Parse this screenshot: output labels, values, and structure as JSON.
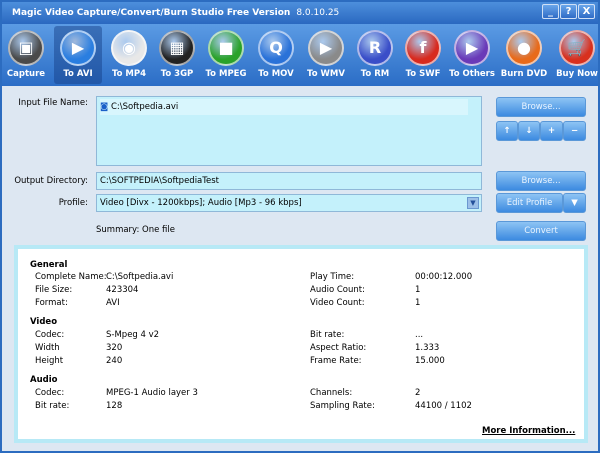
{
  "window": {
    "title": "Magic Video Capture/Convert/Burn Studio Free Version",
    "version": "8.0.10.25",
    "controls": [
      "_",
      "?",
      "X"
    ]
  },
  "toolbar": [
    {
      "label": "Capture",
      "icon": "capture-icon",
      "color": "#4a4a4a",
      "glyph": "▣"
    },
    {
      "label": "To AVI",
      "icon": "play-icon",
      "color": "#2a7ee0",
      "glyph": "▶",
      "selected": true
    },
    {
      "label": "To MP4",
      "icon": "ipod-icon",
      "color": "#e8e8e8",
      "glyph": "◉"
    },
    {
      "label": "To 3GP",
      "icon": "phone-icon",
      "color": "#222222",
      "glyph": "▦"
    },
    {
      "label": "To MPEG",
      "icon": "camera-icon",
      "color": "#2aa22a",
      "glyph": "■"
    },
    {
      "label": "To MOV",
      "icon": "quicktime-icon",
      "color": "#2a72d8",
      "glyph": "Q"
    },
    {
      "label": "To WMV",
      "icon": "wmv-icon",
      "color": "#8a8a8a",
      "glyph": "▶"
    },
    {
      "label": "To RM",
      "icon": "realmedia-icon",
      "color": "#3a4ec8",
      "glyph": "R"
    },
    {
      "label": "To SWF",
      "icon": "flash-icon",
      "color": "#d82a1e",
      "glyph": "f"
    },
    {
      "label": "To Others",
      "icon": "others-icon",
      "color": "#6a3ab8",
      "glyph": "▶"
    },
    {
      "label": "Burn DVD",
      "icon": "dvd-icon",
      "color": "#e86a1a",
      "glyph": "●"
    },
    {
      "label": "Buy Now",
      "icon": "cart-icon",
      "color": "#d8301e",
      "glyph": "🛒"
    }
  ],
  "form": {
    "input_label": "Input File Name:",
    "input_file": "C:\\Softpedia.avi",
    "output_label": "Output Directory:",
    "output_dir": "C:\\SOFTPEDIA\\SoftpediaTest",
    "profile_label": "Profile:",
    "profile": "Video [Divx - 1200kbps]; Audio [Mp3 - 96 kbps]",
    "summary": "Summary: One file",
    "browse": "Browse...",
    "browse2": "Browse...",
    "edit_profile": "Edit Profile",
    "convert": "Convert",
    "move_up": "↑",
    "move_down": "↓",
    "add": "+",
    "remove": "−"
  },
  "info": {
    "general": "General",
    "complete_name_l": "Complete Name:",
    "complete_name": "C:\\Softpedia.avi",
    "file_size_l": "File Size:",
    "file_size": "423304",
    "format_l": "Format:",
    "format": "AVI",
    "play_time_l": "Play Time:",
    "play_time": "00:00:12.000",
    "audio_count_l": "Audio Count:",
    "audio_count": "1",
    "video_count_l": "Video Count:",
    "video_count": "1",
    "video": "Video",
    "vcodec_l": "Codec:",
    "vcodec": "S-Mpeg 4 v2",
    "width_l": "Width",
    "width": "320",
    "height_l": "Height",
    "height": "240",
    "vbitrate_l": "Bit rate:",
    "vbitrate": "...",
    "aspect_l": "Aspect Ratio:",
    "aspect": "1.333",
    "framerate_l": "Frame Rate:",
    "framerate": "15.000",
    "audio": "Audio",
    "acodec_l": "Codec:",
    "acodec": "MPEG-1 Audio layer 3",
    "abitrate_l": "Bit rate:",
    "abitrate": "128",
    "channels_l": "Channels:",
    "channels": "2",
    "sampling_l": "Sampling Rate:",
    "sampling": "44100 / 1102",
    "more": "More Information..."
  }
}
